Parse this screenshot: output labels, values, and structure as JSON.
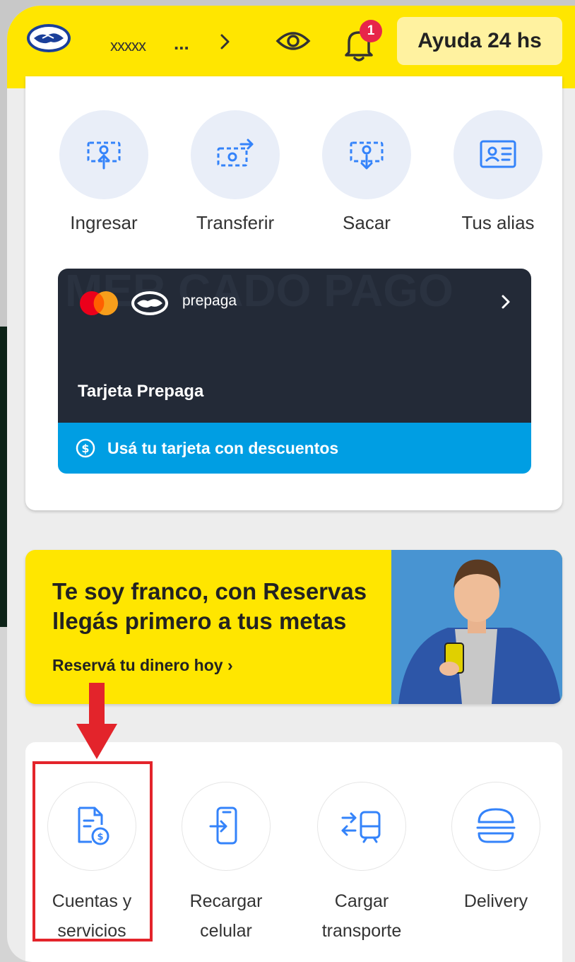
{
  "header": {
    "user_name": "xxxxx",
    "user_dots": "...",
    "badge_count": "1",
    "help_label": "Ayuda 24 hs"
  },
  "actions": [
    {
      "label": "Ingresar",
      "icon": "money-in-icon"
    },
    {
      "label": "Transferir",
      "icon": "money-transfer-icon"
    },
    {
      "label": "Sacar",
      "icon": "money-out-icon"
    },
    {
      "label": "Tus alias",
      "icon": "id-card-icon"
    }
  ],
  "prepaid_card": {
    "watermark": "MER CADO PAGO",
    "brand_label": "prepaga",
    "title": "Tarjeta Prepaga",
    "promo": "Usá tu tarjeta con descuentos"
  },
  "banner": {
    "title": "Te soy franco, con Reservas llegás primero a tus metas",
    "link": "Reservá tu dinero hoy  ›"
  },
  "services": [
    {
      "label": "Cuentas y servicios",
      "icon": "bill-icon"
    },
    {
      "label": "Recargar celular",
      "icon": "phone-recharge-icon"
    },
    {
      "label": "Cargar transporte",
      "icon": "transport-icon"
    },
    {
      "label": "Delivery",
      "icon": "burger-icon"
    }
  ],
  "colors": {
    "yellow": "#ffe600",
    "blue": "#009ee3",
    "dark_card": "#232a37",
    "icon_blue": "#3483fa",
    "highlight_red": "#e3242b"
  }
}
